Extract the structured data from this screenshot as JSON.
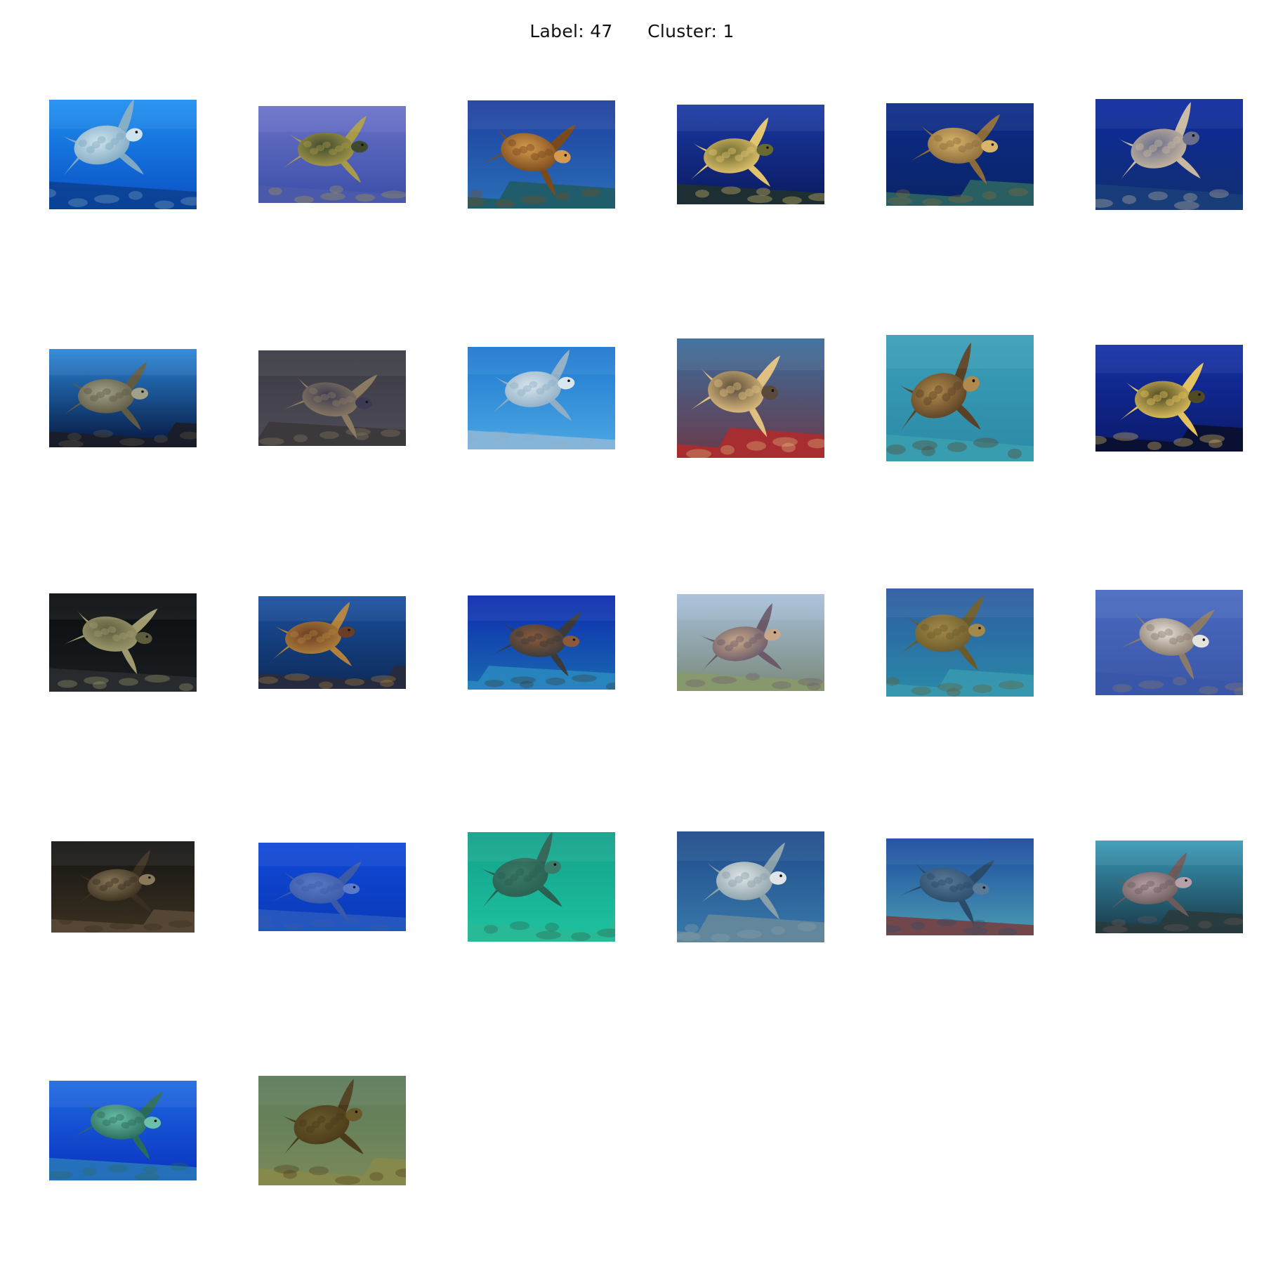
{
  "figure": {
    "title": "Label: 47      Cluster: 1"
  },
  "thumbnails": [
    {
      "subject": "sea-turtle",
      "scene": "bright-blue",
      "bg": [
        "#1e8ff0",
        "#0a4fc4"
      ],
      "shell": [
        "#cfe3ee",
        "#7fa9c2"
      ],
      "seabed": "#0b3f8e"
    },
    {
      "subject": "sea-turtle",
      "scene": "purple-blue",
      "bg": [
        "#6a72c8",
        "#3b4ea8"
      ],
      "shell": [
        "#3d4a2e",
        "#a89a4a"
      ],
      "seabed": "#4c5aa8"
    },
    {
      "subject": "sea-turtle",
      "scene": "vignette-reef",
      "bg": [
        "#1e3e9e",
        "#2a6fb8"
      ],
      "shell": [
        "#d69a4c",
        "#7a4a1c"
      ],
      "seabed": "#1f5a5e"
    },
    {
      "subject": "sea-turtle",
      "scene": "deep-blue",
      "bg": [
        "#1b3aa6",
        "#0a1a5e"
      ],
      "shell": [
        "#6b6a2e",
        "#e3c46e"
      ],
      "seabed": "#21322a"
    },
    {
      "subject": "sea-turtle",
      "scene": "dark-reef",
      "bg": [
        "#0c2b8a",
        "#0a2466"
      ],
      "shell": [
        "#d8b46a",
        "#8a6a3a"
      ],
      "seabed": "#2f6a62"
    },
    {
      "subject": "sea-turtle",
      "scene": "navy",
      "bg": [
        "#0d2aa0",
        "#112e6e"
      ],
      "shell": [
        "#6a6e8a",
        "#c9b8a0"
      ],
      "seabed": "#1a3f7a"
    },
    {
      "subject": "sea-turtle",
      "scene": "sunlit",
      "bg": [
        "#2b86d8",
        "#06163e"
      ],
      "shell": [
        "#a3a08a",
        "#5e5a44"
      ],
      "seabed": "#1c1c24"
    },
    {
      "subject": "sea-turtle",
      "scene": "dark-closeup",
      "bg": [
        "#3a3a44",
        "#4e4c56"
      ],
      "shell": [
        "#3c3a52",
        "#8a7a62"
      ],
      "seabed": "#3a3638"
    },
    {
      "subject": "sea-turtle",
      "scene": "clear-blue",
      "bg": [
        "#1f78d0",
        "#4aa6e2"
      ],
      "shell": [
        "#d9e6ee",
        "#8faec6"
      ],
      "seabed": "#8fb8d8"
    },
    {
      "subject": "sea-turtle",
      "scene": "red-coral",
      "bg": [
        "#3b6c9c",
        "#6a3a4a"
      ],
      "shell": [
        "#5a4a3a",
        "#e0c080"
      ],
      "seabed": "#b32a2a"
    },
    {
      "subject": "sea-turtle",
      "scene": "teal-diver",
      "bg": [
        "#3a9eb8",
        "#2c8aa6"
      ],
      "shell": [
        "#b08a4c",
        "#5a4024"
      ],
      "seabed": "#3aa0b0"
    },
    {
      "subject": "sea-turtle",
      "scene": "cobalt",
      "bg": [
        "#1530a8",
        "#0a1a6a"
      ],
      "shell": [
        "#4e4a24",
        "#e2c25e"
      ],
      "seabed": "#0a0e28"
    },
    {
      "subject": "sea-turtle",
      "scene": "black-frame",
      "bg": [
        "#0a0c0e",
        "#1a1e20"
      ],
      "shell": [
        "#5e5e3e",
        "#9e9a6e"
      ],
      "seabed": "#2a2e30"
    },
    {
      "subject": "sea-turtle",
      "scene": "dark-teal",
      "bg": [
        "#1a50a0",
        "#0e2a58"
      ],
      "shell": [
        "#6a3e24",
        "#b0803c"
      ],
      "seabed": "#2a2a3a"
    },
    {
      "subject": "sea-turtle",
      "scene": "deep-reef",
      "bg": [
        "#0c2ab0",
        "#1a6ab0"
      ],
      "shell": [
        "#8a5a3a",
        "#3a3a3a"
      ],
      "seabed": "#2a8ac0"
    },
    {
      "subject": "sea-turtle",
      "scene": "pale-reef",
      "bg": [
        "#a8c0dc",
        "#7a8a7a"
      ],
      "shell": [
        "#c8a888",
        "#6a5a6a"
      ],
      "seabed": "#8a9a6a"
    },
    {
      "subject": "sea-turtle",
      "scene": "reef-teal",
      "bg": [
        "#2c5aa0",
        "#2a8aa8"
      ],
      "shell": [
        "#a48a4a",
        "#6a5a2a"
      ],
      "seabed": "#3a9ab0"
    },
    {
      "subject": "sea-turtle",
      "scene": "shadow-box",
      "bg": [
        "#4a6ac0",
        "#3a56a8"
      ],
      "shell": [
        "#e6e2dc",
        "#8a7a6a"
      ],
      "seabed": "#3a56a8"
    },
    {
      "subject": "sea-turtle",
      "scene": "night-reef",
      "bg": [
        "#141414",
        "#3a3020"
      ],
      "shell": [
        "#8a7a5a",
        "#3a2e1e"
      ],
      "seabed": "#5a4a3a"
    },
    {
      "subject": "sea-turtle",
      "scene": "royal-blue",
      "bg": [
        "#1048d8",
        "#0a3ab8"
      ],
      "shell": [
        "#5a7ac8",
        "#3a5aa8"
      ],
      "seabed": "#2a5ac0"
    },
    {
      "subject": "sea-turtle",
      "scene": "green-water",
      "bg": [
        "#13a08a",
        "#1ec2a0"
      ],
      "shell": [
        "#3a7a6a",
        "#2a6050"
      ],
      "seabed": "#2ab894"
    },
    {
      "subject": "sea-turtle",
      "scene": "coral-field",
      "bg": [
        "#1e4a8a",
        "#3a7aaa"
      ],
      "shell": [
        "#e0e6e8",
        "#8aa0a8"
      ],
      "seabed": "#6a8a9a"
    },
    {
      "subject": "sea-turtle",
      "scene": "fish-reef",
      "bg": [
        "#1a4aa0",
        "#4a9ab0"
      ],
      "shell": [
        "#5a7a9a",
        "#2a4a6a"
      ],
      "seabed": "#7a3a3a"
    },
    {
      "subject": "sea-turtle",
      "scene": "shallow-teal",
      "bg": [
        "#3a9ab8",
        "#1a3a4a"
      ],
      "shell": [
        "#b8a0a8",
        "#6a5a5a"
      ],
      "seabed": "#2a3a3a"
    },
    {
      "subject": "sea-turtle",
      "scene": "open-blue",
      "bg": [
        "#1e6ae0",
        "#0a32c0"
      ],
      "shell": [
        "#6ac0a8",
        "#2a6a5a"
      ],
      "seabed": "#2a7ab8"
    },
    {
      "subject": "sea-turtle",
      "scene": "murky-green",
      "bg": [
        "#5a7a5a",
        "#7a8a5a"
      ],
      "shell": [
        "#6a5a2a",
        "#4a3a1a"
      ],
      "seabed": "#8a8a4a"
    }
  ]
}
